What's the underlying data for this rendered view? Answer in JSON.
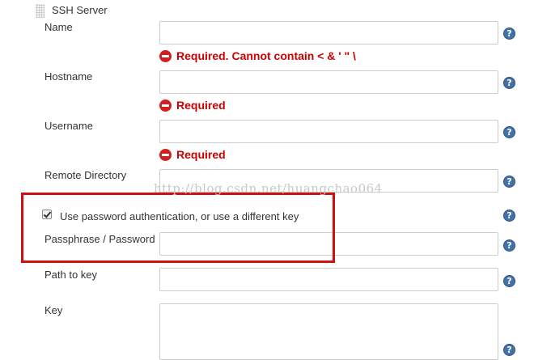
{
  "section": {
    "title": "SSH Server"
  },
  "fields": {
    "name": {
      "label": "Name",
      "value": "",
      "error": "Required. Cannot contain < & ' \" \\"
    },
    "hostname": {
      "label": "Hostname",
      "value": "",
      "error": "Required"
    },
    "username": {
      "label": "Username",
      "value": "",
      "error": "Required"
    },
    "remote_directory": {
      "label": "Remote Directory",
      "value": ""
    },
    "use_password": {
      "label": "Use password authentication, or use a different key",
      "checked": true
    },
    "passphrase": {
      "label": "Passphrase / Password",
      "value": ""
    },
    "path_to_key": {
      "label": "Path to key",
      "value": ""
    },
    "key": {
      "label": "Key",
      "value": ""
    }
  },
  "help_icon_glyph": "?",
  "watermark": "http://blog.csdn.net/huangchao064",
  "colors": {
    "error": "#cc0000",
    "highlight_box": "#cc1111",
    "help_icon": "#4472a8"
  }
}
